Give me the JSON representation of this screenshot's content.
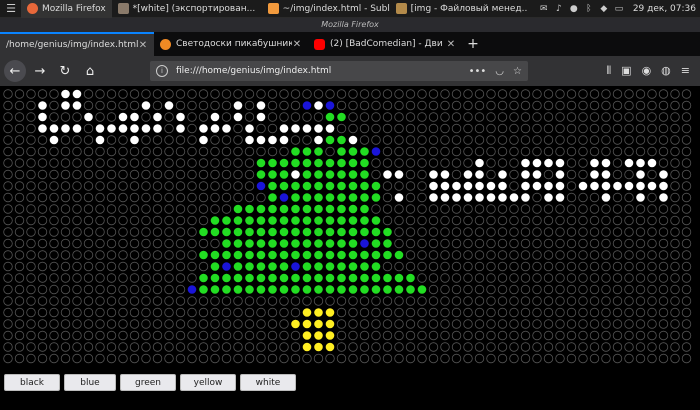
{
  "taskbar": {
    "items": [
      {
        "label": "Mozilla Firefox",
        "icon": "firefox-icon",
        "color": "#e8683a"
      },
      {
        "label": "*[white] (экспортирован...",
        "icon": "gimp-icon",
        "color": "#8a7a6a"
      },
      {
        "label": "~/img/index.html - Sublim...",
        "icon": "sublime-icon",
        "color": "#f29a3d"
      },
      {
        "label": "[img - Файловый менед...",
        "icon": "folder-icon",
        "color": "#b38a4a"
      }
    ],
    "tray_icons": [
      "mail-icon",
      "volume-icon",
      "steam-icon",
      "bluetooth-icon",
      "vpn-icon",
      "display-icon"
    ],
    "clock": "29 дек, 07:36"
  },
  "window": {
    "title": "Mozilla Firefox"
  },
  "tabs": [
    {
      "label": "/home/genius/img/index.html",
      "active": true
    },
    {
      "label": "Светодоски пикабушников",
      "favicon_color": "#f08a24"
    },
    {
      "label": "(2) [BadComedian] - Дви",
      "favicon_color": "#ff0000"
    }
  ],
  "nav": {
    "url": "file:///home/genius/img/index.html",
    "icons": [
      "back-arrow-icon",
      "forward-arrow-icon",
      "reload-icon",
      "home-icon"
    ]
  },
  "palette": {
    "off": "#000000",
    "white": "#ffffff",
    "green": "#22dd22",
    "blue": "#1a14d8",
    "yellow": "#ffee22",
    "outline": "#555555"
  },
  "buttons": [
    {
      "label": "black",
      "key": "black"
    },
    {
      "label": "blue",
      "key": "blue"
    },
    {
      "label": "green",
      "key": "green"
    },
    {
      "label": "yellow",
      "key": "yellow"
    },
    {
      "label": "white",
      "key": "white"
    }
  ],
  "led_board": {
    "columns": 60,
    "rows": 24,
    "legend": ".=off W=white G=green B=blue Y=yellow",
    "cells": [
      ".....WW.....................................................",
      "...W.WW.....W.W.....W.W...BWB...............................",
      "...W...W..WW.W.W..W.W.W.....GG..............................",
      "...WWWW.WWWWWW.W.WWW.W..WWWWW...............................",
      "....W...W..W.....W...WWWW..WGGW.............................",
      ".........................GGG.GGGB...........................",
      "......................GGGGGGGGGG.........W...WWWW..WW.WWW...",
      "......................GGGWGGGGGG.WW..WW.WW.W.WW.W..WW..W.W..",
      "......................BGGGGGGGGGG....WWWWWWW.WWWW.WWWWWWWW..",
      ".......................GBGGGGGGGG.W..WWWWWWWWW.WW...W..W.W..",
      "....................GGGGGGGGGGGG............................",
      "..................GGGGGGGGGGGGGGG...........................",
      ".................GGGGGGGGGGGGGGGGG..........................",
      "...................GGGGGGGGGGGGBGG..........................",
      ".................GGGGGGGGGGGGGGGGGG.........................",
      "..................GBGGGGGBGGGGGGG...........................",
      ".................GGGGGGGGGGGGGGGGGGG........................",
      "................BGGGGGGGGGGGGGGGGGGGG.......................",
      "....................................................................",
      "..........................YYY...............................",
      ".........................YYYY...............................",
      "..........................YYY...............................",
      "..........................YYY...............................",
      "............................................................"
    ]
  }
}
